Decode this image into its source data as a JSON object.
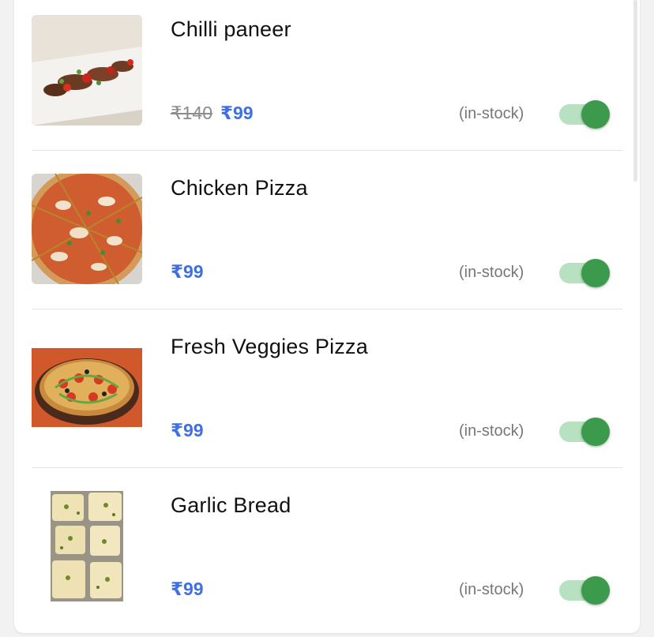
{
  "menu": {
    "items": [
      {
        "name": "Chilli paneer",
        "old_price": "₹140",
        "price": "₹99",
        "stock": "(in-stock)",
        "available": true,
        "image": "chilli-paneer-photo"
      },
      {
        "name": "Chicken Pizza",
        "price": "₹99",
        "stock": "(in-stock)",
        "available": true,
        "image": "chicken-pizza-photo"
      },
      {
        "name": "Fresh Veggies Pizza",
        "price": "₹99",
        "stock": "(in-stock)",
        "available": true,
        "image": "veggie-pizza-photo"
      },
      {
        "name": "Garlic Bread",
        "price": "₹99",
        "stock": "(in-stock)",
        "available": true,
        "image": "garlic-bread-photo"
      }
    ]
  },
  "colors": {
    "price": "#3f6fe0",
    "old_price": "#8c8c8c",
    "toggle_track_on": "#b7e1c0",
    "toggle_knob_on": "#3b9a4b"
  }
}
